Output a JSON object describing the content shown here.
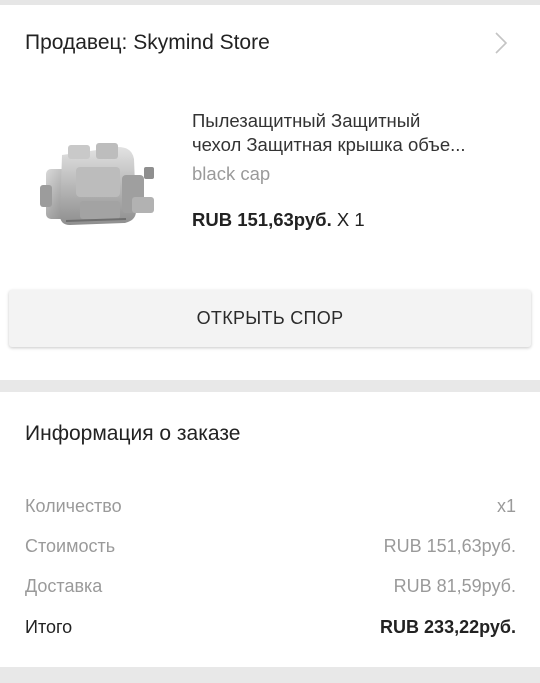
{
  "seller": {
    "label": "Продавец: Skymind Store",
    "chevron_icon": "chevron-right-icon"
  },
  "product": {
    "title_line1": "Пылезащитный Защитный",
    "title_line2": "чехол Защитная крышка объе...",
    "variant": "black cap",
    "price": "RUB 151,63руб.",
    "quantity": " X 1",
    "image_icon": "gimbal-camera-cap-image"
  },
  "actions": {
    "open_dispute": "ОТКРЫТЬ СПОР"
  },
  "order_info": {
    "title": "Информация о заказе",
    "rows": [
      {
        "label": "Количество",
        "value": "x1"
      },
      {
        "label": "Стоимость",
        "value": "RUB 151,63руб."
      },
      {
        "label": "Доставка",
        "value": "RUB 81,59руб."
      }
    ],
    "total": {
      "label": "Итого",
      "value": "RUB 233,22руб."
    }
  },
  "colors": {
    "background": "#eeeeee",
    "card": "#ffffff",
    "muted_text": "#9a9a9a",
    "text": "#222222"
  }
}
